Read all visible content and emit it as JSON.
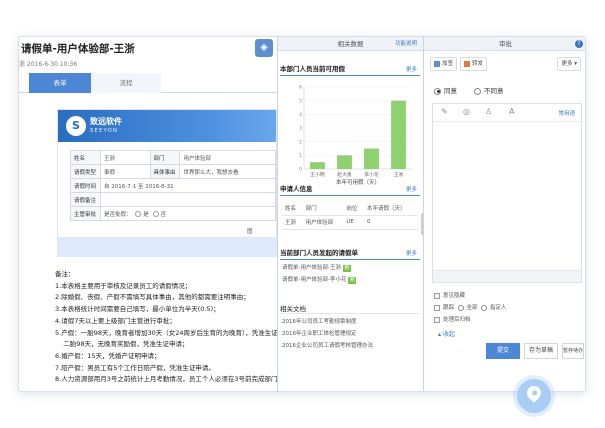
{
  "doc": {
    "title": "请假单-用户体验部-王浙",
    "meta": "浙 2016-6-30 10:36"
  },
  "left_tabs": [
    "表单",
    "流程"
  ],
  "form": {
    "logo_cn": "致远软件",
    "logo_en": "SEEYON",
    "rows": [
      {
        "label": "姓名",
        "value": "王浙",
        "label2": "部门",
        "value2": "用户体验部"
      },
      {
        "label": "请假类型",
        "value": "事假",
        "label2": "具体事由",
        "value2": "世界那么大，我想去看"
      },
      {
        "label": "请假时间",
        "value": "自 2016-7-1 至 2016-8-31"
      },
      {
        "label": "请假备注",
        "value": ""
      },
      {
        "label": "主管审批",
        "value": "是否批假：",
        "opt1": "是",
        "opt2": "否"
      }
    ],
    "footnote": "图"
  },
  "notes": [
    "备注：",
    "1.本表格主要用于审核及记录员工的请假情况；",
    "2.除婚假、丧假、产假不需填写具体事由，其他的都需要注明事由；",
    "3.本表格统计时间需要自己填写，最小单位为半天(0.5)；",
    "4.请假7天以上要上级部门主管进行审批；",
    "5.产假：一胎98天，晚育者增加30天（女24周岁后生育的为晚育），凭准生证申请",
    "    二胎98天，无晚育奖励假，凭准生证申请；",
    "6.婚产假：15天，凭婚产证明申请；",
    "7.陪产假：男员工有5个工作日陪产假，凭准生证申请。",
    "8.人力资源部用月3号之前统计上月考勤情况，员工个人必须在3号前完成部门主"
  ],
  "mid": {
    "header": "相关数据",
    "header_link": "功能说明",
    "sec1_title": "本部门人员当前可用假",
    "more": "更多",
    "sec2_title": "申请人信息",
    "sec3_title": "当前部门人员发起的请假单",
    "sec4_title": "相关文档",
    "info_headers": [
      "姓名",
      "部门",
      "岗位",
      "本年请假（天）"
    ],
    "info_row": [
      "王浙",
      "用户体验部",
      "UE",
      "0"
    ],
    "requests": [
      "请假单-用户体验部-王浙",
      "请假单-用户体验部-李小花"
    ],
    "new_badge": "新",
    "docs": [
      "2016年公司员工考勤规章制度",
      "2016年企业职工体检管理规定",
      "2016企业公司员工请假考核管理办法"
    ]
  },
  "chart_data": {
    "type": "bar",
    "categories": [
      "王小明",
      "赵大勇",
      "李小花",
      "王浙"
    ],
    "values": [
      0.5,
      1,
      1.5,
      5
    ],
    "ylim": [
      0,
      6
    ],
    "yticks": [
      0,
      1,
      2,
      3,
      4,
      5,
      6
    ],
    "xlabel": "本年可用假（天）",
    "color": "#8fd170"
  },
  "right": {
    "header": "审批",
    "help": "?",
    "btn_add": "加签",
    "btn_forward": "转发",
    "btn_more": "更多",
    "agree": "同意",
    "disagree": "不同意",
    "phrase": "常用语",
    "opinion_hidden": "意见隐藏",
    "track": "跟踪",
    "track_all": "全部",
    "track_assigned": "指定人",
    "archive": "处理后归档",
    "collapse": "收起",
    "submit": "提交",
    "draft": "存为草稿",
    "wait": "暂存待办"
  }
}
